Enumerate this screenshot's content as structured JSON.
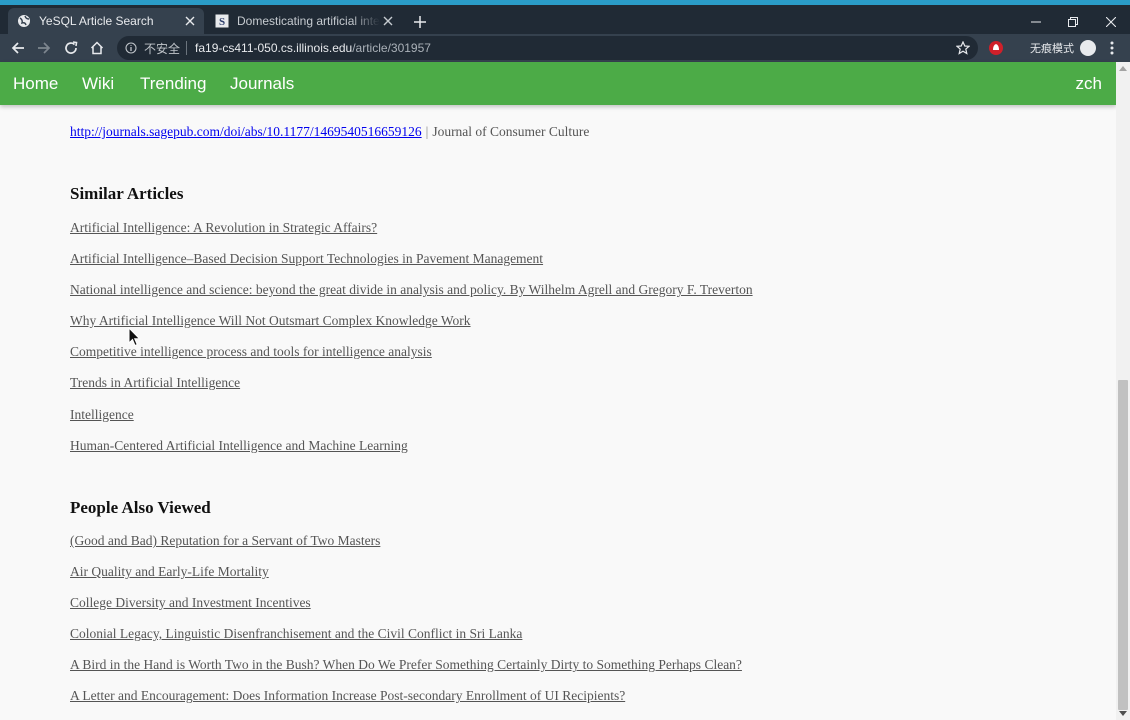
{
  "browser": {
    "tabs": [
      {
        "title": "YeSQL Article Search",
        "active": true,
        "favicon": "globe-icon"
      },
      {
        "title": "Domesticating artificial intelligence",
        "active": false,
        "favicon": "sage-s-icon"
      }
    ],
    "address": {
      "security_label": "不安全",
      "host": "fa19-cs411-050.cs.illinois.edu",
      "path": "/article/301957"
    },
    "incognito_label": "无痕模式",
    "colors": {
      "tabbar": "#202a35",
      "toolbar": "#35414e",
      "accent_strip": "#2a9cc8"
    }
  },
  "site_nav": {
    "links": [
      "Home",
      "Wiki",
      "Trending",
      "Journals"
    ],
    "user": "zch",
    "color": "#4cab47"
  },
  "article": {
    "doi_link": "http://journals.sagepub.com/doi/abs/10.1177/1469540516659126",
    "separator": "|",
    "journal": "Journal of Consumer Culture"
  },
  "similar": {
    "heading": "Similar Articles",
    "items": [
      "Artificial Intelligence: A Revolution in Strategic Affairs?",
      "Artificial Intelligence–Based Decision Support Technologies in Pavement Management",
      "National intelligence and science: beyond the great divide in analysis and policy. By Wilhelm Agrell and Gregory F. Treverton",
      "Why Artificial Intelligence Will Not Outsmart Complex Knowledge Work",
      "Competitive intelligence process and tools for intelligence analysis",
      "Trends in Artificial Intelligence",
      "Intelligence",
      "Human-Centered Artificial Intelligence and Machine Learning"
    ]
  },
  "also_viewed": {
    "heading": "People Also Viewed",
    "items": [
      "(Good and Bad) Reputation for a Servant of Two Masters",
      "Air Quality and Early-Life Mortality",
      "College Diversity and Investment Incentives",
      "Colonial Legacy, Linguistic Disenfranchisement and the Civil Conflict in Sri Lanka",
      "A Bird in the Hand is Worth Two in the Bush? When Do We Prefer Something Certainly Dirty to Something Perhaps Clean?",
      "A Letter and Encouragement: Does Information Increase Post-secondary Enrollment of UI Recipients?"
    ]
  }
}
